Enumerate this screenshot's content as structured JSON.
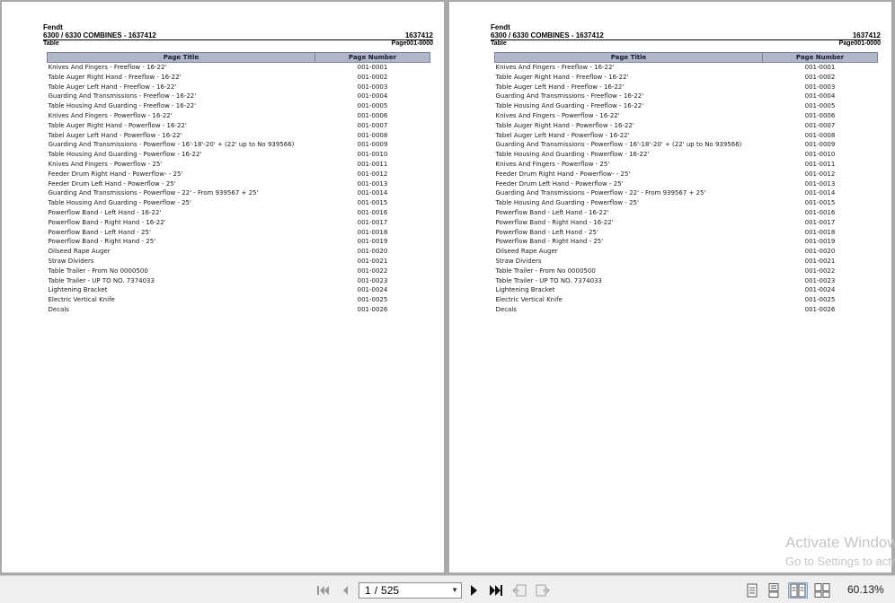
{
  "document": {
    "brand": "Fendt",
    "title": "6300 / 6330 COMBINES - 1637412",
    "doc_number": "1637412",
    "section": "Table",
    "page_ref": "Page001-0000",
    "columns": {
      "title": "Page Title",
      "number": "Page Number"
    },
    "rows": [
      [
        "Knives And Fingers - Freeflow - 16-22'",
        "001-0001"
      ],
      [
        "Table Auger Right Hand - Freeflow - 16-22'",
        "001-0002"
      ],
      [
        "Table Auger Left Hand - Freeflow - 16-22'",
        "001-0003"
      ],
      [
        "Guarding And Transmissions - Freeflow - 16-22'",
        "001-0004"
      ],
      [
        "Table Housing And Guarding - Freeflow - 16-22'",
        "001-0005"
      ],
      [
        "Knives And Fingers - Powerflow - 16-22'",
        "001-0006"
      ],
      [
        "Table Auger Right Hand - Powerflow - 16-22'",
        "001-0007"
      ],
      [
        "Tabel Auger Left Hand - Powerflow - 16-22'",
        "001-0008"
      ],
      [
        "Guarding And Transmissions - Powerflow - 16'-18'-20' + (22' up to No 939566)",
        "001-0009"
      ],
      [
        "Table Housing And Guarding - Powerflow - 16-22'",
        "001-0010"
      ],
      [
        "Knives And Fingers - Powerflow - 25'",
        "001-0011"
      ],
      [
        "Feeder Drum Right Hand - Powerflow- - 25'",
        "001-0012"
      ],
      [
        "Feeder Drum Left Hand - Powerflow - 25'",
        "001-0013"
      ],
      [
        "Guarding And Transmissions - Powerflow - 22' - From 939567 + 25'",
        "001-0014"
      ],
      [
        "Table Housing And Guarding - Powerflow - 25'",
        "001-0015"
      ],
      [
        "Powerflow Band - Left Hand - 16-22'",
        "001-0016"
      ],
      [
        "Powerflow Band - Right Hand - 16-22'",
        "001-0017"
      ],
      [
        "Powerflow Band - Left Hand - 25'",
        "001-0018"
      ],
      [
        "Powerflow Band - Right Hand - 25'",
        "001-0019"
      ],
      [
        "Oilseed Rape Auger",
        "001-0020"
      ],
      [
        "Straw Dividers",
        "001-0021"
      ],
      [
        "Table Trailer - From No 0000500",
        "001-0022"
      ],
      [
        "Table Trailer - UP TO NO. 7374033",
        "001-0023"
      ],
      [
        "Lightening Bracket",
        "001-0024"
      ],
      [
        "Electric Vertical Knife",
        "001-0025"
      ],
      [
        "Decals",
        "001-0026"
      ]
    ]
  },
  "watermark": {
    "line1": "Activate Windows",
    "line2": "Go to Settings to activate Windows."
  },
  "toolbar": {
    "current_page": "1",
    "separator": "/",
    "total_pages": "525",
    "zoom": "60.13%",
    "icons": [
      "first-page-icon",
      "previous-page-icon",
      "next-page-icon",
      "last-page-icon",
      "previous-view-icon",
      "next-view-icon",
      "single-page-view-icon",
      "continuous-view-icon",
      "facing-view-icon",
      "continuous-facing-view-icon"
    ]
  },
  "colors": {
    "table_header_bg": "#b1b6c9",
    "viewer_bg": "#a9a9a9",
    "toolbar_bg": "#efefef"
  }
}
